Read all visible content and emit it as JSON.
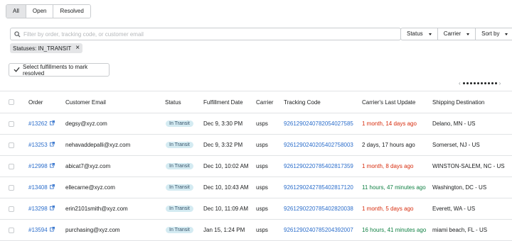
{
  "tabs": [
    "All",
    "Open",
    "Resolved"
  ],
  "search": {
    "placeholder": "Filter by order, tracking code, or customer email"
  },
  "filters": {
    "status": "Status",
    "carrier": "Carrier",
    "sort": "Sort by"
  },
  "chip": {
    "label": "Statuses: IN_TRANSIT"
  },
  "mark_button": "Select fulfillments to mark resolved",
  "pager": {
    "prev": "‹",
    "next": "›"
  },
  "columns": [
    "Order",
    "Customer Email",
    "Status",
    "Fulfillment Date",
    "Carrier",
    "Tracking Code",
    "Carrier's Last Update",
    "Shipping Destination"
  ],
  "colors": {
    "link": "#2c6ecb",
    "overdue": "#d72c0d",
    "recent": "#108043",
    "badge_bg": "#d4ebf2"
  },
  "rows": [
    {
      "order": "#13262",
      "email": "degsy@xyz.com",
      "status": "In Transit",
      "date": "Dec 9, 3:30 PM",
      "carrier": "usps",
      "tracking": "9261290240782054027585",
      "last_update": "1 month, 14 days ago",
      "update_state": "overdue",
      "destination": "Delano, MN - US"
    },
    {
      "order": "#13253",
      "email": "nehavaddepalli@xyz.com",
      "status": "In Transit",
      "date": "Dec 9, 3:32 PM",
      "carrier": "usps",
      "tracking": "9261290240205402758003",
      "last_update": "2 days, 17 hours ago",
      "update_state": "normal",
      "destination": "Somerset, NJ - US"
    },
    {
      "order": "#12998",
      "email": "abicat7@xyz.com",
      "status": "In Transit",
      "date": "Dec 10, 10:02 AM",
      "carrier": "usps",
      "tracking": "9261290220785402817359",
      "last_update": "1 month, 8 days ago",
      "update_state": "overdue",
      "destination": "WINSTON-SALEM, NC - US"
    },
    {
      "order": "#13408",
      "email": "ellecarne@xyz.com",
      "status": "In Transit",
      "date": "Dec 10, 10:43 AM",
      "carrier": "usps",
      "tracking": "9261290242785402817120",
      "last_update": "11 hours, 47 minutes ago",
      "update_state": "recent",
      "destination": "Washington, DC - US"
    },
    {
      "order": "#13298",
      "email": "erin2101smith@xyz.com",
      "status": "In Transit",
      "date": "Dec 10, 11:09 AM",
      "carrier": "usps",
      "tracking": "9261290220785402820038",
      "last_update": "1 month, 5 days ago",
      "update_state": "overdue",
      "destination": "Everett, WA - US"
    },
    {
      "order": "#13594",
      "email": "purchasing@xyz.com",
      "status": "In Transit",
      "date": "Jan 15, 1:24 PM",
      "carrier": "usps",
      "tracking": "9261290240785204392007",
      "last_update": "16 hours, 41 minutes ago",
      "update_state": "recent",
      "destination": "miami beach, FL - US"
    }
  ]
}
